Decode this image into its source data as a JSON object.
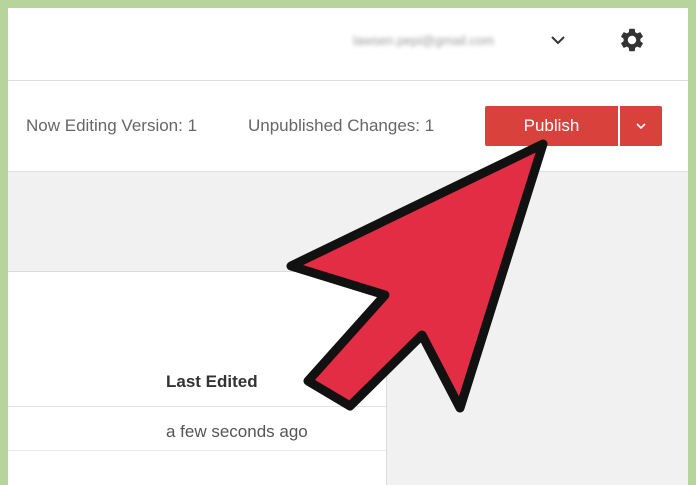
{
  "header": {
    "account_email": "lawsen.pepi@gmail.com",
    "icons": {
      "account_menu": "chevron-down-icon",
      "settings": "gear-icon"
    }
  },
  "toolbar": {
    "editing_version": "Now Editing Version: 1",
    "unpublished_changes": "Unpublished Changes: 1",
    "publish_label": "Publish",
    "publish_menu_icon": "chevron-down-icon",
    "publish_color": "#d9413d"
  },
  "table": {
    "columns": [
      "Last Edited"
    ],
    "rows": [
      [
        "a few seconds ago"
      ]
    ]
  },
  "overlay": {
    "pointer_arrow_color": "#e22d44"
  }
}
